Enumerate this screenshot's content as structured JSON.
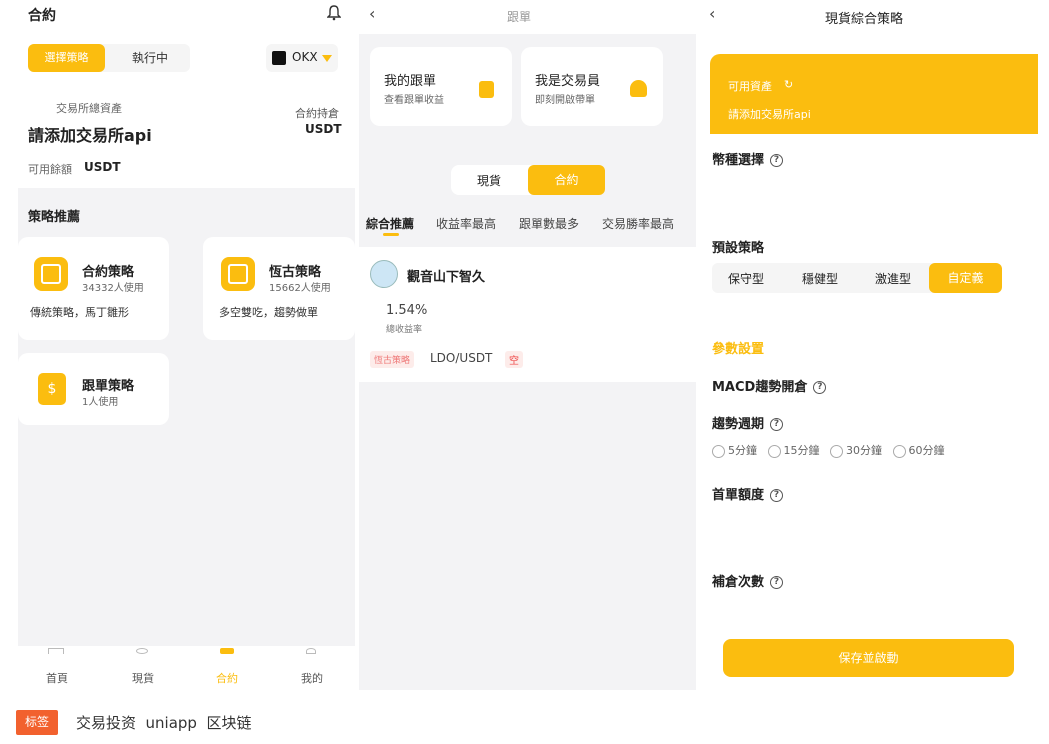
{
  "p1": {
    "title": "合約",
    "tabs": [
      "選擇策略",
      "執行中"
    ],
    "exchange": "OKX",
    "total_assets_label": "交易所總資產",
    "total_assets_value": "請添加交易所api",
    "position_label": "合約持倉",
    "position_unit": "USDT",
    "available_label": "可用餘額",
    "available_unit": "USDT",
    "section_title": "策略推薦",
    "strategies": [
      {
        "name": "合約策略",
        "users": "34332人使用",
        "desc": "傳統策略，馬丁雛形"
      },
      {
        "name": "恆古策略",
        "users": "15662人使用",
        "desc": "多空雙吃，趨勢做單"
      },
      {
        "name": "跟單策略",
        "users": "1人使用"
      }
    ],
    "nav": [
      "首頁",
      "現貨",
      "合約",
      "我的"
    ]
  },
  "p2": {
    "header_title": "跟單",
    "cards": [
      {
        "title": "我的跟單",
        "sub": "查看跟單收益"
      },
      {
        "title": "我是交易員",
        "sub": "即刻開啟帶單"
      }
    ],
    "toggle": [
      "現貨",
      "合約"
    ],
    "filters": [
      "綜合推薦",
      "收益率最高",
      "跟單數最多",
      "交易勝率最高"
    ],
    "trader": {
      "name": "觀音山下智久",
      "profit": "1.54%",
      "profit_label": "總收益率",
      "tag": "恆古策略",
      "pair": "LDO/USDT",
      "side": "空"
    }
  },
  "p3": {
    "title": "現貨綜合策略",
    "available": "可用資產",
    "add_api": "請添加交易所api",
    "coin_select": "幣種選擇",
    "preset": "預設策略",
    "presets": [
      "保守型",
      "穩健型",
      "激進型",
      "自定義"
    ],
    "params": "參數設置",
    "macd": "MACD趨勢開倉",
    "period": "趨勢週期",
    "periods": [
      "5分鐘",
      "15分鐘",
      "30分鐘",
      "60分鐘"
    ],
    "first_amount": "首單額度",
    "refill_times": "補倉次數",
    "save": "保存並啟動"
  },
  "footer": {
    "tag": "标签",
    "keywords": "交易投资  uniapp  区块链"
  },
  "colors": {
    "accent": "#fbbd0f",
    "tag": "#f2612e"
  }
}
